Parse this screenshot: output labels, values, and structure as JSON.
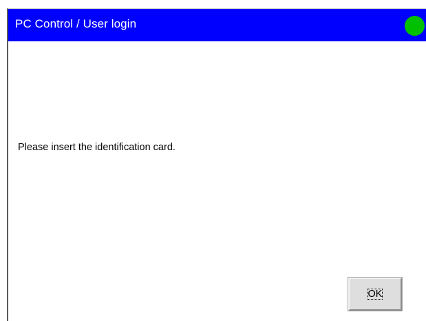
{
  "window": {
    "title": "PC Control / User login",
    "status_indicator": {
      "icon": "status-led-icon",
      "state": "connected",
      "color": "#00c000"
    },
    "titlebar_color": "#0000ff"
  },
  "content": {
    "message": "Please insert the identification card."
  },
  "buttons": {
    "ok_label": "OK"
  }
}
